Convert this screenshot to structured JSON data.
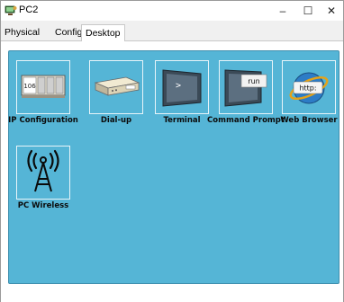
{
  "window": {
    "title": "PC2",
    "icon": "computer-icon",
    "controls": {
      "minimize": "–",
      "maximize": "☐",
      "close": "✕"
    }
  },
  "tabs": [
    {
      "label": "Physical",
      "selected": false
    },
    {
      "label": "Config",
      "selected": false
    },
    {
      "label": "Desktop",
      "selected": true
    }
  ],
  "desktop": {
    "background_color": "#55b5d6",
    "apps": [
      {
        "label": "IP Configuration",
        "icon": "ip-config-icon",
        "icon_text": "106"
      },
      {
        "label": "Dial-up",
        "icon": "modem-icon"
      },
      {
        "label": "Terminal",
        "icon": "terminal-icon",
        "icon_text": ">"
      },
      {
        "label": "Command Prompt",
        "icon": "command-prompt-icon",
        "icon_text": "run"
      },
      {
        "label": "Web Browser",
        "icon": "web-browser-icon",
        "icon_text": "http:"
      },
      {
        "label": "PC Wireless",
        "icon": "wireless-antenna-icon"
      }
    ]
  }
}
